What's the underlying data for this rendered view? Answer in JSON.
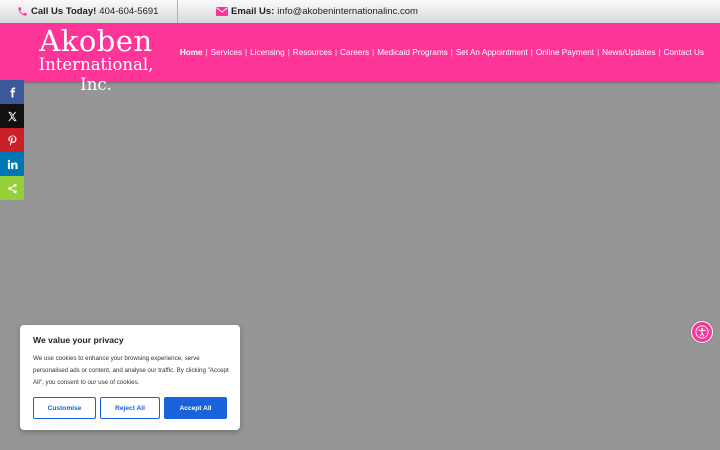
{
  "topbar": {
    "phone_label": "Call Us Today!",
    "phone_number": "404-604-5691",
    "email_label": "Email Us:",
    "email_address": "info@akobeninternationalinc.com"
  },
  "logo": {
    "line1": "Akoben",
    "line2": "International, Inc."
  },
  "nav": {
    "items": [
      {
        "label": "Home"
      },
      {
        "label": "Services"
      },
      {
        "label": "Licensing"
      },
      {
        "label": "Resources"
      },
      {
        "label": "Careers"
      },
      {
        "label": "Medicaid Programs"
      },
      {
        "label": "Set An Appointment"
      },
      {
        "label": "Online Payment"
      },
      {
        "label": "News/Updates"
      },
      {
        "label": "Contact Us"
      }
    ],
    "separator": "|"
  },
  "share": {
    "buttons": [
      {
        "icon": "facebook-icon",
        "color": "#3b5998"
      },
      {
        "icon": "x-twitter-icon",
        "color": "#111111"
      },
      {
        "icon": "pinterest-icon",
        "color": "#cb2027"
      },
      {
        "icon": "linkedin-icon",
        "color": "#0077b5"
      },
      {
        "icon": "share-icon",
        "color": "#95d03a"
      }
    ]
  },
  "cookie": {
    "title": "We value your privacy",
    "text": "We use cookies to enhance your browsing experience, serve personalised ads or content, and analyse our traffic. By clicking \"Accept All\", you consent to our use of cookies.",
    "customise_label": "Customise",
    "reject_label": "Reject All",
    "accept_label": "Accept All"
  },
  "colors": {
    "brand_pink": "#fd3598",
    "page_bg": "#969696",
    "button_blue": "#1863dc"
  }
}
